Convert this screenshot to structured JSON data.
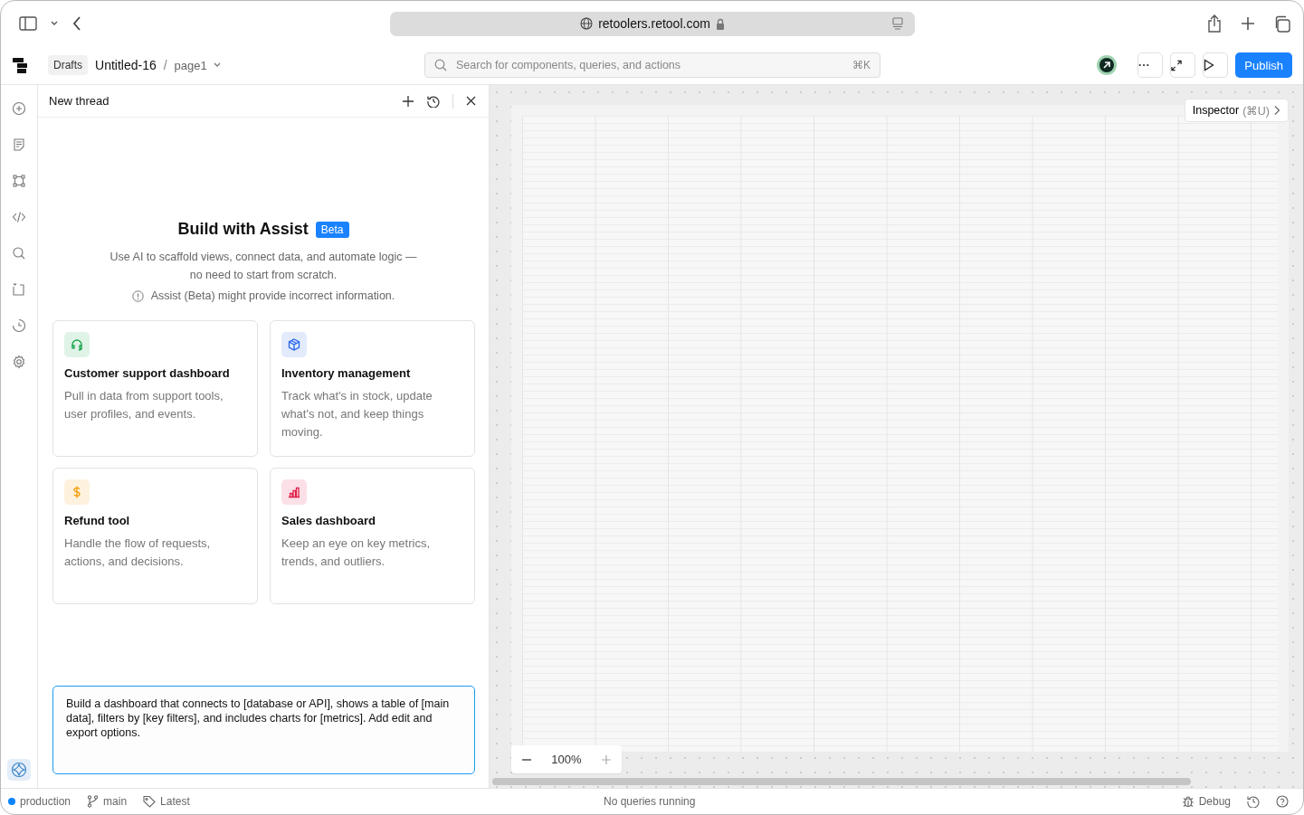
{
  "browser": {
    "url": "retoolers.retool.com"
  },
  "header": {
    "folder": "Drafts",
    "app_name": "Untitled-16",
    "separator": "/",
    "page": "page1",
    "search": {
      "placeholder": "Search for components, queries, and actions",
      "shortcut": "⌘K"
    },
    "publish": "Publish"
  },
  "rail": {
    "items": [
      {
        "kind": "add",
        "selected": false
      },
      {
        "kind": "pages",
        "selected": false
      },
      {
        "kind": "tree",
        "selected": false
      },
      {
        "kind": "code",
        "selected": false
      },
      {
        "kind": "search",
        "selected": false
      },
      {
        "kind": "module",
        "selected": false
      },
      {
        "kind": "history",
        "selected": false
      },
      {
        "kind": "settings",
        "selected": false
      }
    ],
    "assist": {
      "selected": true
    }
  },
  "panel": {
    "title": "New thread",
    "hero_title": "Build with Assist",
    "badge": "Beta",
    "description": "Use AI to scaffold views, connect data, and automate logic — no need to start from scratch.",
    "warning": "Assist (Beta) might provide incorrect information.",
    "cards": [
      {
        "kind": "headset",
        "color": "#16a34a",
        "title": "Customer support dashboard",
        "description": "Pull in data from support tools, user profiles, and events."
      },
      {
        "kind": "box",
        "color": "#2563eb",
        "title": "Inventory management",
        "description": "Track what's in stock, update what's not, and keep things moving."
      },
      {
        "kind": "dollar",
        "color": "#f59e0b",
        "title": "Refund tool",
        "description": "Handle the flow of requests, actions, and decisions."
      },
      {
        "kind": "chart",
        "color": "#e11d48",
        "title": "Sales dashboard",
        "description": "Keep an eye on key metrics, trends, and outliers."
      }
    ],
    "prompt": "Build a dashboard that connects to [database or API], shows a table of [main data], filters by [key filters], and includes charts for [metrics]. Add edit and export options."
  },
  "canvas": {
    "inspector": "Inspector",
    "inspector_shortcut": "(⌘U)",
    "zoom": "100%"
  },
  "status_bar": {
    "environment": {
      "label": "production",
      "color": "#0a84ff"
    },
    "branch": "main",
    "tag": "Latest",
    "queries": "No queries running",
    "debug": "Debug"
  }
}
